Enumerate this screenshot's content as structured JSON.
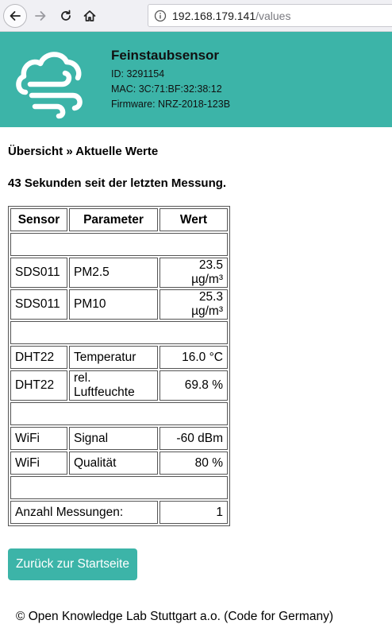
{
  "browser": {
    "url_host": "192.168.179.141",
    "url_path": "/values"
  },
  "header": {
    "title": "Feinstaubsensor",
    "id_line": "ID: 3291154",
    "mac_line": "MAC: 3C:71:BF:32:38:12",
    "firmware_line": "Firmware: NRZ-2018-123B",
    "logo_icon": "cloud-wind-icon",
    "accent_color": "#3cb4a8"
  },
  "breadcrumb": "Übersicht » Aktuelle Werte",
  "status": "43 Sekunden seit der letzten Messung.",
  "table": {
    "headers": [
      "Sensor",
      "Parameter",
      "Wert"
    ],
    "rows": [
      {
        "sensor": "SDS011",
        "parameter": "PM2.5",
        "value": "23.5 µg/m³"
      },
      {
        "sensor": "SDS011",
        "parameter": "PM10",
        "value": "25.3 µg/m³"
      },
      {
        "sensor": "DHT22",
        "parameter": "Temperatur",
        "value": "16.0 °C"
      },
      {
        "sensor": "DHT22",
        "parameter": "rel. Luftfeuchte",
        "value": "69.8 %"
      },
      {
        "sensor": "WiFi",
        "parameter": "Signal",
        "value": "-60 dBm"
      },
      {
        "sensor": "WiFi",
        "parameter": "Qualität",
        "value": "80 %"
      }
    ],
    "count_label": "Anzahl Messungen:",
    "count_value": "1"
  },
  "back_button": "Zurück zur Startseite",
  "footer": "© Open Knowledge Lab Stuttgart a.o. (Code for Germany)"
}
